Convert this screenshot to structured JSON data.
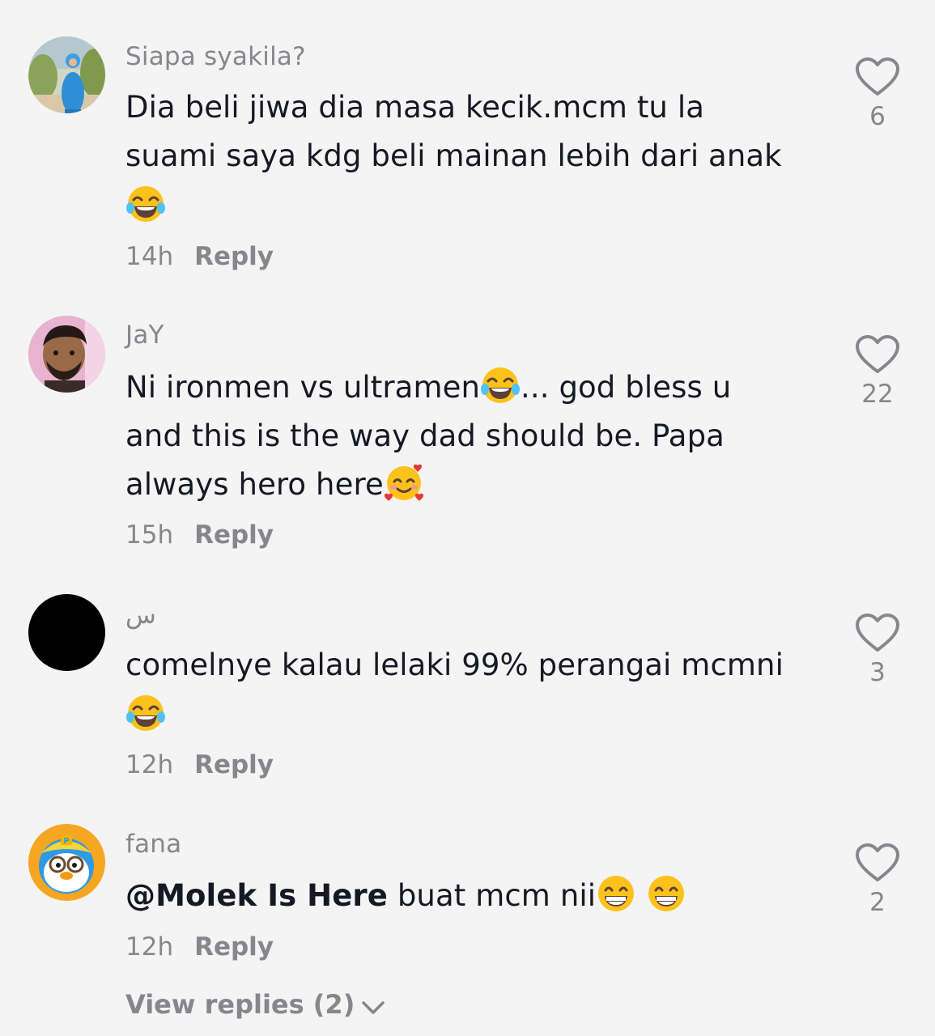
{
  "comments": [
    {
      "username": "Siapa syakila?",
      "lines": [
        "Dia beli jiwa dia masa kecik.mcm tu la",
        "suami saya kdg beli mainan lebih dari anak"
      ],
      "time": "14h",
      "reply_label": "Reply",
      "likes": "6",
      "avatar_icon": "woman-in-blue-avatar",
      "emojis": [
        "face-with-tears-of-joy"
      ]
    },
    {
      "username": "JaY",
      "line1": "Ni ironmen vs ultramen",
      "line1_tail": "... god bless u",
      "line2": "and this is the way dad should be. Papa",
      "line3": "always hero here",
      "time": "15h",
      "reply_label": "Reply",
      "likes": "22",
      "avatar_icon": "man-selfie-avatar",
      "emojis": [
        "face-with-tears-of-joy",
        "smiling-face-with-hearts"
      ]
    },
    {
      "username": "س",
      "lines": [
        "comelnye kalau lelaki 99% perangai mcmni"
      ],
      "time": "12h",
      "reply_label": "Reply",
      "likes": "3",
      "avatar_icon": "black-circle-avatar",
      "emojis": [
        "face-with-tears-of-joy"
      ]
    },
    {
      "username": "fana",
      "mention": "@Molek Is Here",
      "text": " buat mcm nii",
      "time": "12h",
      "reply_label": "Reply",
      "likes": "2",
      "avatar_icon": "cartoon-penguin-avatar",
      "emojis": [
        "grinning-face-with-smiling-eyes",
        "grinning-face-with-smiling-eyes"
      ]
    }
  ],
  "view_replies_label": "View replies (2)",
  "colors": {
    "background": "#f4f4f5",
    "text": "#161823",
    "muted": "#86878b"
  }
}
